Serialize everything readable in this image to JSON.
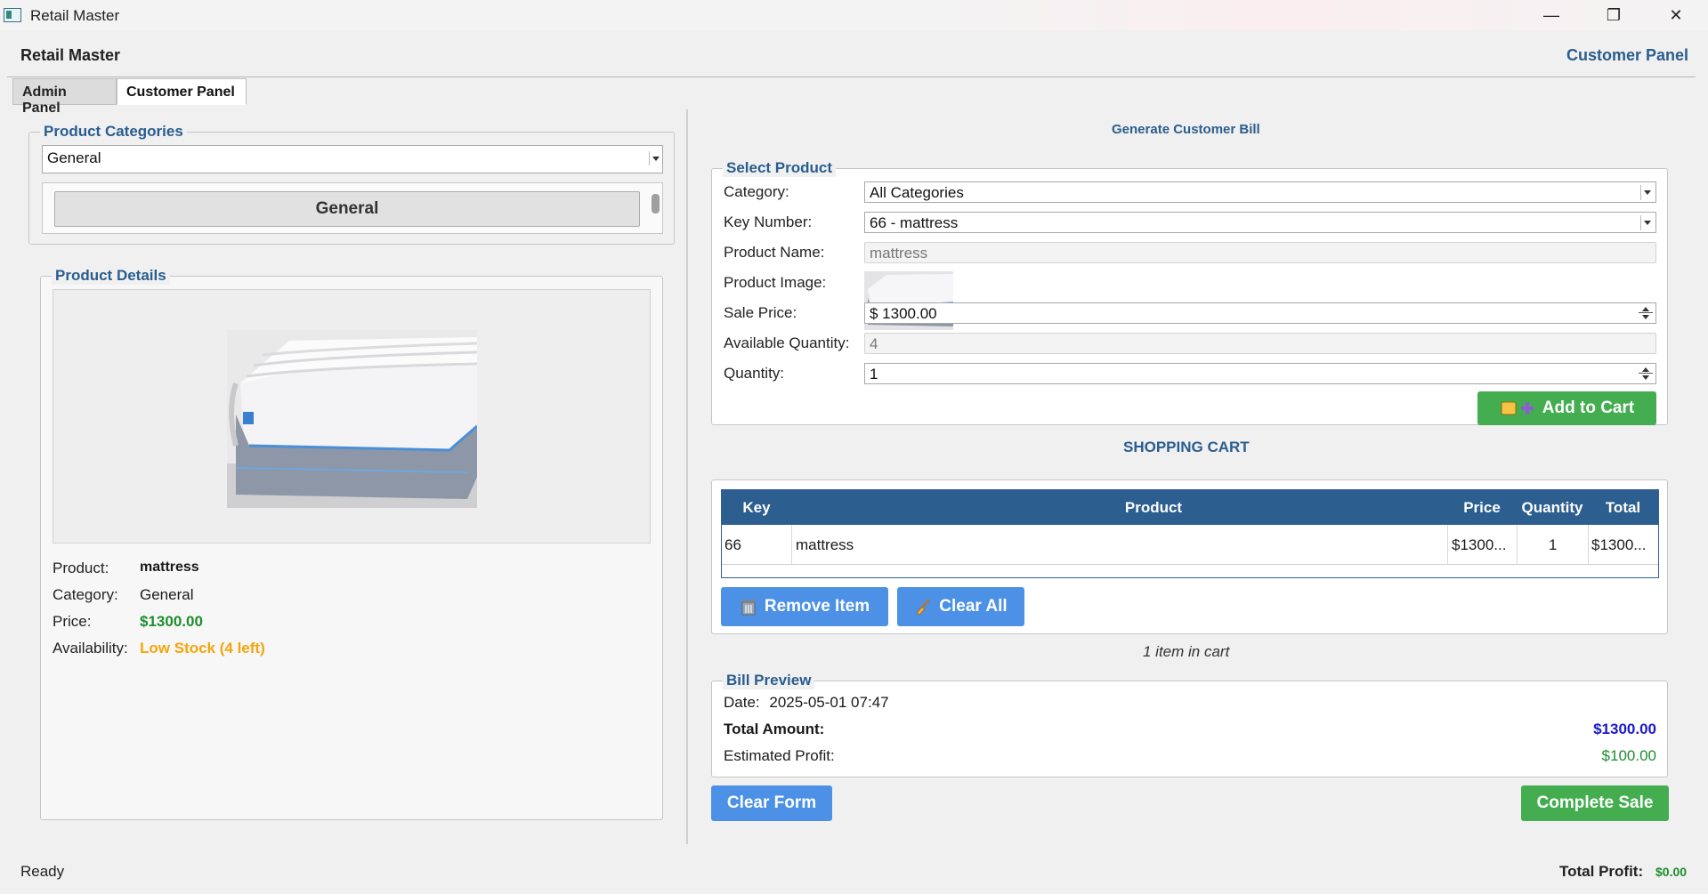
{
  "window": {
    "title": "Retail Master",
    "minimize": "—",
    "maximize": "❐",
    "close": "✕"
  },
  "header": {
    "title": "Retail Master",
    "panel": "Customer Panel"
  },
  "tabs": [
    {
      "label": "Admin Panel"
    },
    {
      "label": "Customer Panel"
    }
  ],
  "categories": {
    "legend": "Product Categories",
    "selected": "General",
    "buttons": [
      "General"
    ]
  },
  "details": {
    "legend": "Product Details",
    "product_label": "Product:",
    "product_value": "mattress",
    "category_label": "Category:",
    "category_value": "General",
    "price_label": "Price:",
    "price_value": "$1300.00",
    "availability_label": "Availability:",
    "availability_value": "Low Stock (4 left)"
  },
  "bill": {
    "heading": "Generate Customer Bill",
    "select": {
      "legend": "Select Product",
      "category_label": "Category:",
      "category_value": "All Categories",
      "key_label": "Key Number:",
      "key_value": "66 - mattress",
      "name_label": "Product Name:",
      "name_value": "mattress",
      "image_label": "Product Image:",
      "price_label": "Sale Price:",
      "price_value": "$ 1300.00",
      "avail_label": "Available Quantity:",
      "avail_value": "4",
      "qty_label": "Quantity:",
      "qty_value": "1",
      "add_button": "Add to Cart"
    },
    "cart": {
      "title": "SHOPPING CART",
      "columns": [
        "Key",
        "Product",
        "Price",
        "Quantity",
        "Total"
      ],
      "rows": [
        {
          "key": "66",
          "product": "mattress",
          "price": "$1300...",
          "quantity": "1",
          "total": "$1300..."
        }
      ],
      "remove_button": "Remove Item",
      "clear_all_button": "Clear All",
      "count_text": "1 item in cart"
    },
    "preview": {
      "legend": "Bill Preview",
      "date_label": "Date:",
      "date_value": "2025-05-01 07:47",
      "total_label": "Total Amount:",
      "total_value": "$1300.00",
      "profit_label": "Estimated Profit:",
      "profit_value": "$100.00"
    },
    "clear_form_button": "Clear Form",
    "complete_sale_button": "Complete Sale"
  },
  "status": {
    "text": "Ready",
    "total_profit_label": "Total Profit:",
    "total_profit_value": "$0.00"
  },
  "colors": {
    "accent": "#2a5d8f",
    "green": "#43ad4f",
    "blue_button": "#4c91e6",
    "warning": "#f5a50a",
    "price_green": "#1e8c2e",
    "total_blue": "#1a1acc"
  }
}
